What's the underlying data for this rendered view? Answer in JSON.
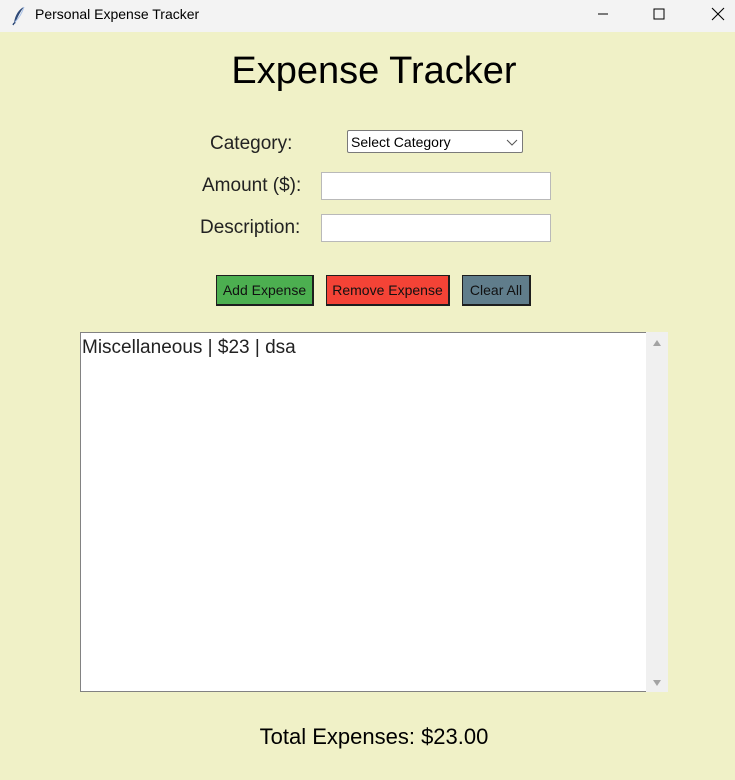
{
  "window": {
    "title": "Personal Expense Tracker",
    "icon": "feather-icon"
  },
  "app": {
    "heading": "Expense Tracker"
  },
  "form": {
    "category_label": "Category:",
    "category_selected": "Select Category",
    "amount_label": "Amount ($):",
    "amount_value": "",
    "description_label": "Description:",
    "description_value": ""
  },
  "buttons": {
    "add": "Add Expense",
    "remove": "Remove Expense",
    "clear": "Clear All"
  },
  "expenses": [
    "Miscellaneous | $23 | dsa"
  ],
  "total": "Total Expenses: $23.00",
  "colors": {
    "background": "#f0f1c7",
    "add_button": "#4caf50",
    "remove_button": "#f44336",
    "clear_button": "#607d8b"
  }
}
